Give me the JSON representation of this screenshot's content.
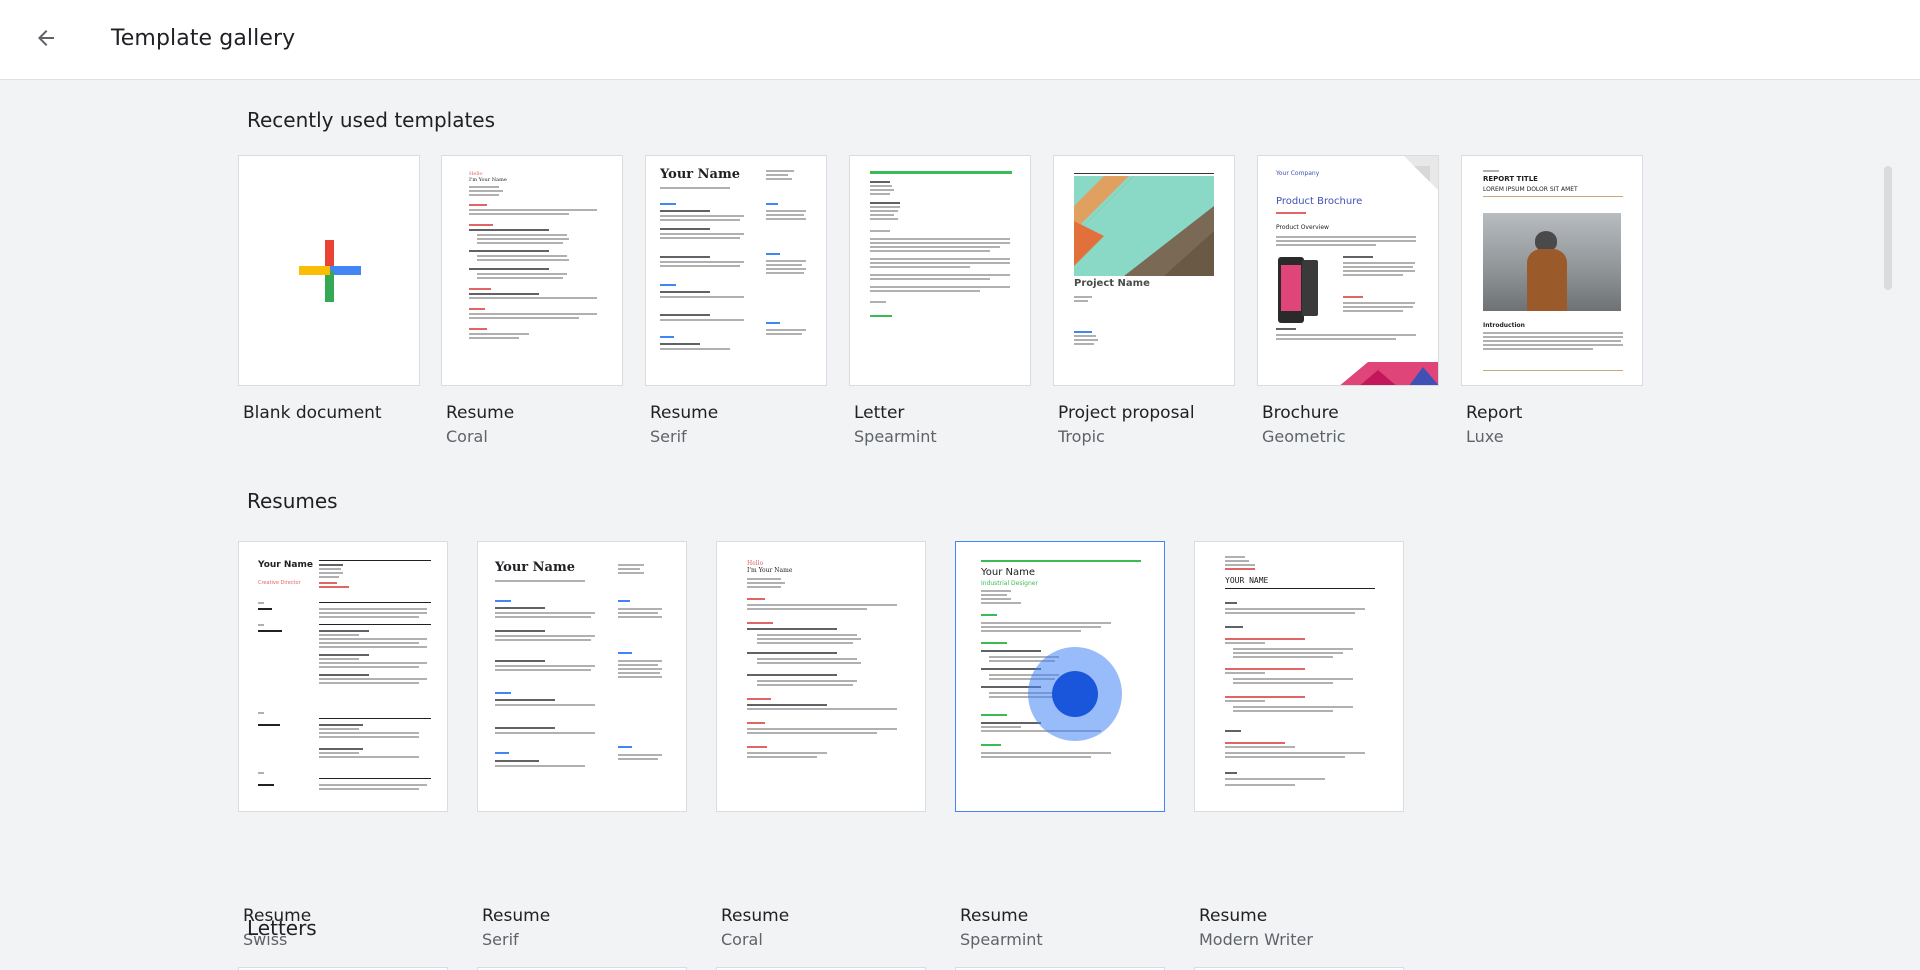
{
  "header": {
    "title": "Template gallery",
    "back_icon": "arrow-back-icon"
  },
  "sections": {
    "recent": {
      "title": "Recently used templates",
      "items": [
        {
          "name": "Blank document",
          "sub": ""
        },
        {
          "name": "Resume",
          "sub": "Coral"
        },
        {
          "name": "Resume",
          "sub": "Serif"
        },
        {
          "name": "Letter",
          "sub": "Spearmint"
        },
        {
          "name": "Project proposal",
          "sub": "Tropic"
        },
        {
          "name": "Brochure",
          "sub": "Geometric"
        },
        {
          "name": "Report",
          "sub": "Luxe"
        }
      ]
    },
    "resumes": {
      "title": "Resumes",
      "items": [
        {
          "name": "Resume",
          "sub": "Swiss"
        },
        {
          "name": "Resume",
          "sub": "Serif"
        },
        {
          "name": "Resume",
          "sub": "Coral"
        },
        {
          "name": "Resume",
          "sub": "Spearmint"
        },
        {
          "name": "Resume",
          "sub": "Modern Writer"
        }
      ]
    },
    "letters": {
      "title": "Letters"
    }
  },
  "thumbnails": {
    "serif_name": "Your Name",
    "swiss_name": "Your Name",
    "spearmint_name": "Your Name",
    "spearmint_role": "Industrial Designer",
    "modern_name": "YOUR NAME",
    "proposal_title": "Project Name",
    "brochure_company": "Your Company",
    "brochure_title": "Product Brochure",
    "brochure_overview": "Product Overview",
    "report_label": "REPORT TITLE",
    "report_sub": "LOREM IPSUM DOLOR SIT AMET",
    "report_intro": "Introduction",
    "coral_hello": "Hello",
    "coral_name": "I'm Your Name",
    "swiss_role": "Creative Director"
  },
  "colors": {
    "accent_blue": "#4285f4",
    "google_red": "#ea4335",
    "google_yellow": "#fbbc04",
    "google_green": "#34a853",
    "coral": "#e06666",
    "spearmint": "#3cba54"
  }
}
